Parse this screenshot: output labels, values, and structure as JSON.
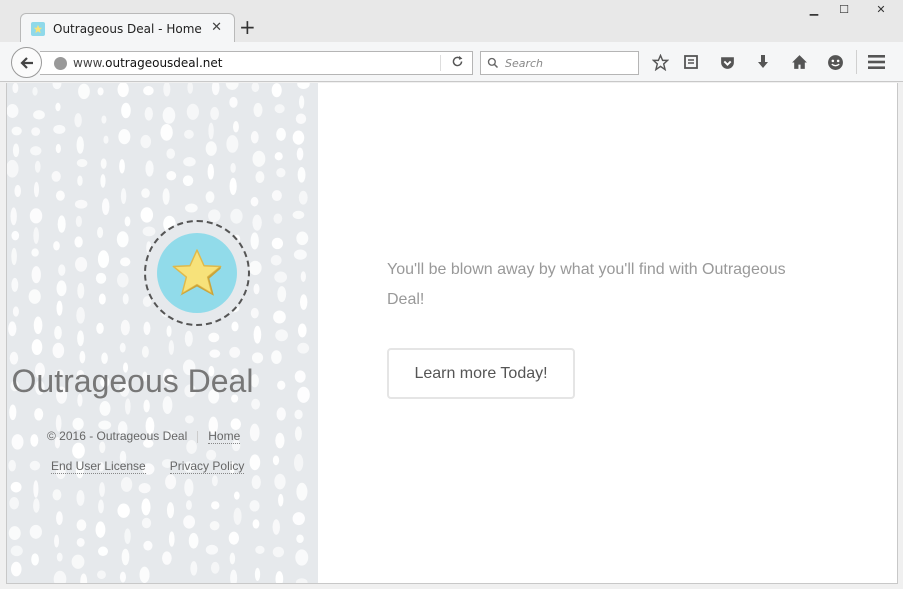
{
  "window": {
    "minimize": "▁",
    "maximize": "☐",
    "close": "✕"
  },
  "tab": {
    "title": "Outrageous Deal - Home ...",
    "close": "✕",
    "new_tab": "+"
  },
  "navbar": {
    "url_prefix": "www.",
    "url_domain": "outrageousdeal.net",
    "search_placeholder": "Search"
  },
  "sidebar": {
    "site_title": "Outrageous Deal",
    "copyright": "© 2016 - Outrageous Deal",
    "home_link": "Home",
    "eula_link": "End User License",
    "privacy_link": "Privacy Policy"
  },
  "main": {
    "tagline": "You'll be blown away by what you'll find with Outrageous Deal!",
    "cta_label": "Learn more Today!"
  },
  "colors": {
    "sidebar_bg": "#e6e9ec",
    "logo_circle": "#91dbea",
    "star": "#f7e27a",
    "text_muted": "#999999"
  }
}
